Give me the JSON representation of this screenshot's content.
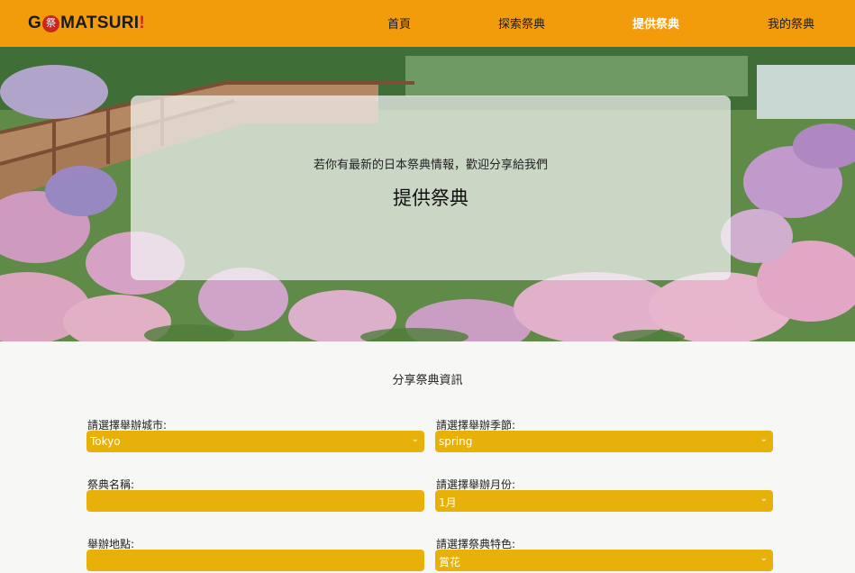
{
  "nav": {
    "logo_g": "G",
    "logo_badge": "祭",
    "logo_text": "MATSURI",
    "logo_mark": "!",
    "links": [
      "首頁",
      "探索祭典",
      "提供祭典",
      "我的祭典"
    ],
    "active_index": 2
  },
  "hero": {
    "subtitle": "若你有最新的日本祭典情報，歡迎分享給我們",
    "title": "提供祭典"
  },
  "form": {
    "section_title": "分享祭典資訊",
    "city_label": "請選擇舉辦城市:",
    "city_value": "Tokyo",
    "season_label": "請選擇舉辦季節:",
    "season_value": "spring",
    "name_label": "祭典名稱:",
    "name_value": "",
    "month_label": "請選擇舉辦月份:",
    "month_value": "1月",
    "location_label": "舉辦地點:",
    "location_value": "",
    "feature_label": "請選擇祭典特色:",
    "feature_value": "賞花"
  },
  "colors": {
    "nav_bg": "#f39c0b",
    "field_bg": "#e8b10a",
    "brand_red": "#c8281f"
  }
}
